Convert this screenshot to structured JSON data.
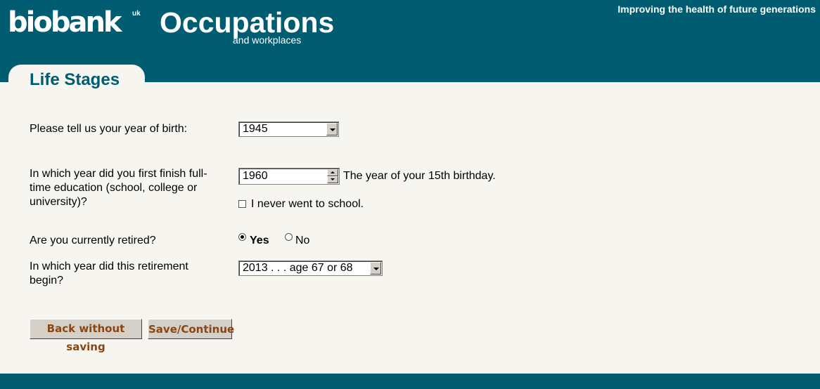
{
  "header": {
    "logo_text": "biobank",
    "logo_suffix": "uk",
    "title": "Occupations",
    "subtitle": "and workplaces"
  },
  "tab": {
    "label": "Life Stages"
  },
  "form": {
    "birth_year": {
      "label": "Please tell us your year of birth:",
      "value": "1945"
    },
    "education": {
      "label": "In which year did you first finish full-time education (school, college or university)?",
      "value": "1960",
      "hint": "The year of your 15th birthday.",
      "never_school_label": "I never went to school.",
      "never_school_checked": false
    },
    "retired": {
      "label": "Are you currently retired?",
      "options": [
        "Yes",
        "No"
      ],
      "selected": "Yes"
    },
    "retirement_year": {
      "label": "In which year did this retirement begin?",
      "value": "2013 . . . age 67 or 68"
    }
  },
  "buttons": {
    "back_label": "Back without saving",
    "continue_label": "Save/Continue"
  },
  "footer": {
    "tagline": "Improving the health of future generations"
  },
  "colors": {
    "brand": "#005c70",
    "background": "#f6f5ef",
    "button_text": "#8b4513"
  }
}
